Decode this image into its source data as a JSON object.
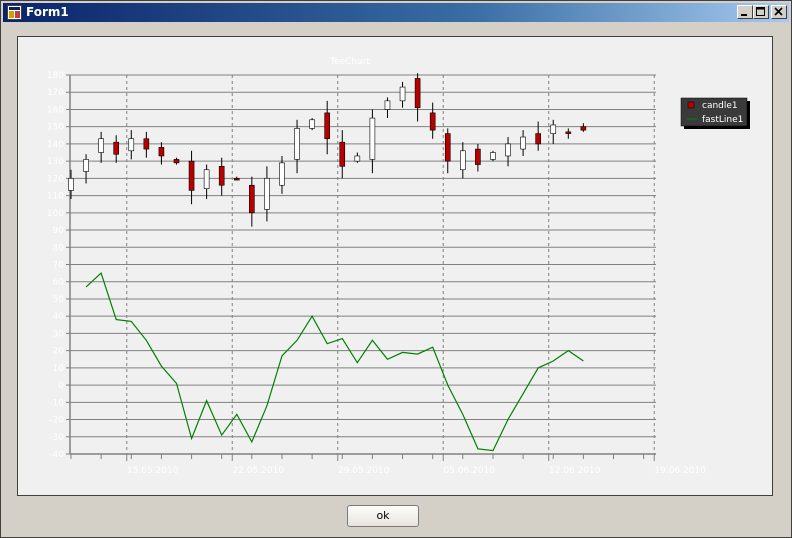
{
  "window": {
    "title": "Form1"
  },
  "buttons": {
    "ok_label": "ok"
  },
  "colors": {
    "candle_down": "#b80000",
    "candle_up": "#ffffff",
    "line": "#008000",
    "grid": "#808080",
    "label": "#ffffff"
  },
  "chart_data": {
    "type": "line",
    "title": "TeeChart",
    "xlabel": "",
    "ylabel": "",
    "ylim": [
      -40,
      180
    ],
    "yticks": [
      180,
      170,
      160,
      150,
      140,
      130,
      120,
      110,
      100,
      90,
      80,
      70,
      60,
      50,
      40,
      30,
      20,
      10,
      0,
      -10,
      -20,
      -30,
      -40
    ],
    "grid": true,
    "legend_position": "right",
    "x_tick_labels": [
      "15.05.2010",
      "22.05.2010",
      "29.05.2010",
      "05.06.2010",
      "12.06.2010",
      "19.06.2010"
    ],
    "series": [
      {
        "name": "candle1",
        "kind": "candle",
        "points": [
          {
            "date": "2010-05-10",
            "open": 113,
            "high": 125,
            "low": 108,
            "close": 120
          },
          {
            "date": "2010-05-11",
            "open": 124,
            "high": 134,
            "low": 117,
            "close": 131
          },
          {
            "date": "2010-05-12",
            "open": 135,
            "high": 147,
            "low": 129,
            "close": 143
          },
          {
            "date": "2010-05-13",
            "open": 141,
            "high": 145,
            "low": 129,
            "close": 134
          },
          {
            "date": "2010-05-14",
            "open": 136,
            "high": 148,
            "low": 131,
            "close": 143
          },
          {
            "date": "2010-05-15",
            "open": 143,
            "high": 147,
            "low": 132,
            "close": 137
          },
          {
            "date": "2010-05-16",
            "open": 138,
            "high": 141,
            "low": 128,
            "close": 133
          },
          {
            "date": "2010-05-17",
            "open": 131,
            "high": 132,
            "low": 128,
            "close": 129
          },
          {
            "date": "2010-05-18",
            "open": 130,
            "high": 136,
            "low": 105,
            "close": 113
          },
          {
            "date": "2010-05-19",
            "open": 114,
            "high": 128,
            "low": 108,
            "close": 125
          },
          {
            "date": "2010-05-20",
            "open": 127,
            "high": 132,
            "low": 110,
            "close": 116
          },
          {
            "date": "2010-05-21",
            "open": 120,
            "high": 121,
            "low": 119,
            "close": 119
          },
          {
            "date": "2010-05-22",
            "open": 116,
            "high": 121,
            "low": 92,
            "close": 100
          },
          {
            "date": "2010-05-23",
            "open": 102,
            "high": 127,
            "low": 95,
            "close": 120
          },
          {
            "date": "2010-05-24",
            "open": 116,
            "high": 133,
            "low": 111,
            "close": 129
          },
          {
            "date": "2010-05-25",
            "open": 131,
            "high": 154,
            "low": 123,
            "close": 149
          },
          {
            "date": "2010-05-26",
            "open": 149,
            "high": 155,
            "low": 148,
            "close": 154
          },
          {
            "date": "2010-05-27",
            "open": 158,
            "high": 165,
            "low": 134,
            "close": 143
          },
          {
            "date": "2010-05-28",
            "open": 141,
            "high": 148,
            "low": 120,
            "close": 127
          },
          {
            "date": "2010-05-29",
            "open": 130,
            "high": 135,
            "low": 129,
            "close": 133
          },
          {
            "date": "2010-05-30",
            "open": 131,
            "high": 160,
            "low": 123,
            "close": 155
          },
          {
            "date": "2010-05-31",
            "open": 160,
            "high": 167,
            "low": 155,
            "close": 165
          },
          {
            "date": "2010-06-01",
            "open": 165,
            "high": 176,
            "low": 161,
            "close": 173
          },
          {
            "date": "2010-06-02",
            "open": 178,
            "high": 181,
            "low": 153,
            "close": 161
          },
          {
            "date": "2010-06-03",
            "open": 158,
            "high": 164,
            "low": 143,
            "close": 148
          },
          {
            "date": "2010-06-04",
            "open": 146,
            "high": 149,
            "low": 123,
            "close": 130
          },
          {
            "date": "2010-06-05",
            "open": 125,
            "high": 141,
            "low": 120,
            "close": 136
          },
          {
            "date": "2010-06-06",
            "open": 137,
            "high": 140,
            "low": 124,
            "close": 128
          },
          {
            "date": "2010-06-07",
            "open": 131,
            "high": 136,
            "low": 130,
            "close": 135
          },
          {
            "date": "2010-06-08",
            "open": 133,
            "high": 144,
            "low": 127,
            "close": 140
          },
          {
            "date": "2010-06-09",
            "open": 137,
            "high": 148,
            "low": 133,
            "close": 144
          },
          {
            "date": "2010-06-10",
            "open": 146,
            "high": 153,
            "low": 136,
            "close": 140
          },
          {
            "date": "2010-06-11",
            "open": 146,
            "high": 154,
            "low": 140,
            "close": 151
          },
          {
            "date": "2010-06-12",
            "open": 147,
            "high": 149,
            "low": 143,
            "close": 146
          },
          {
            "date": "2010-06-13",
            "open": 150,
            "high": 152,
            "low": 147,
            "close": 148
          }
        ]
      },
      {
        "name": "fastLine1",
        "kind": "line",
        "points": [
          {
            "date": "2010-05-11",
            "y": 57
          },
          {
            "date": "2010-05-12",
            "y": 65
          },
          {
            "date": "2010-05-13",
            "y": 38
          },
          {
            "date": "2010-05-14",
            "y": 37
          },
          {
            "date": "2010-05-15",
            "y": 26
          },
          {
            "date": "2010-05-16",
            "y": 11
          },
          {
            "date": "2010-05-17",
            "y": 1
          },
          {
            "date": "2010-05-18",
            "y": -31
          },
          {
            "date": "2010-05-19",
            "y": -9
          },
          {
            "date": "2010-05-20",
            "y": -29
          },
          {
            "date": "2010-05-21",
            "y": -17
          },
          {
            "date": "2010-05-22",
            "y": -33
          },
          {
            "date": "2010-05-23",
            "y": -12
          },
          {
            "date": "2010-05-24",
            "y": 17
          },
          {
            "date": "2010-05-25",
            "y": 26
          },
          {
            "date": "2010-05-26",
            "y": 40
          },
          {
            "date": "2010-05-27",
            "y": 24
          },
          {
            "date": "2010-05-28",
            "y": 27
          },
          {
            "date": "2010-05-29",
            "y": 13
          },
          {
            "date": "2010-05-30",
            "y": 26
          },
          {
            "date": "2010-05-31",
            "y": 15
          },
          {
            "date": "2010-06-01",
            "y": 19
          },
          {
            "date": "2010-06-02",
            "y": 18
          },
          {
            "date": "2010-06-03",
            "y": 22
          },
          {
            "date": "2010-06-04",
            "y": 0
          },
          {
            "date": "2010-06-05",
            "y": -17
          },
          {
            "date": "2010-06-06",
            "y": -37
          },
          {
            "date": "2010-06-07",
            "y": -38
          },
          {
            "date": "2010-06-08",
            "y": -20
          },
          {
            "date": "2010-06-09",
            "y": -5
          },
          {
            "date": "2010-06-10",
            "y": 10
          },
          {
            "date": "2010-06-11",
            "y": 14
          },
          {
            "date": "2010-06-12",
            "y": 20
          },
          {
            "date": "2010-06-13",
            "y": 14
          }
        ]
      }
    ]
  }
}
